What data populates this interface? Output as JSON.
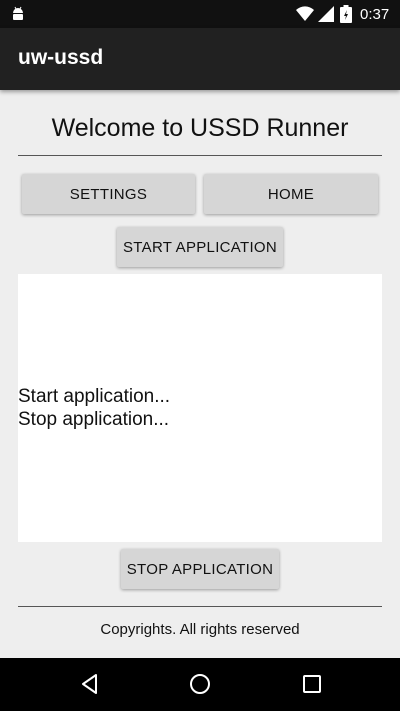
{
  "status_bar": {
    "time": "0:37",
    "icons": [
      "android-icon",
      "wifi-icon",
      "signal-icon",
      "battery-icon"
    ]
  },
  "app_bar": {
    "title": "uw-ussd"
  },
  "main": {
    "heading": "Welcome to USSD Runner",
    "buttons": {
      "settings": "SETTINGS",
      "home": "HOME",
      "start": "START APPLICATION",
      "stop": "STOP APPLICATION"
    },
    "log": [
      "Start application...",
      "Stop application..."
    ]
  },
  "footer": {
    "text": "Copyrights. All rights reserved"
  },
  "nav_bar": {
    "icons": [
      "back-icon",
      "home-icon",
      "recents-icon"
    ]
  },
  "colors": {
    "status_bar": "#111111",
    "app_bar": "#212121",
    "background": "#eeeeee",
    "button": "#d6d6d6",
    "log_bg": "#ffffff"
  }
}
